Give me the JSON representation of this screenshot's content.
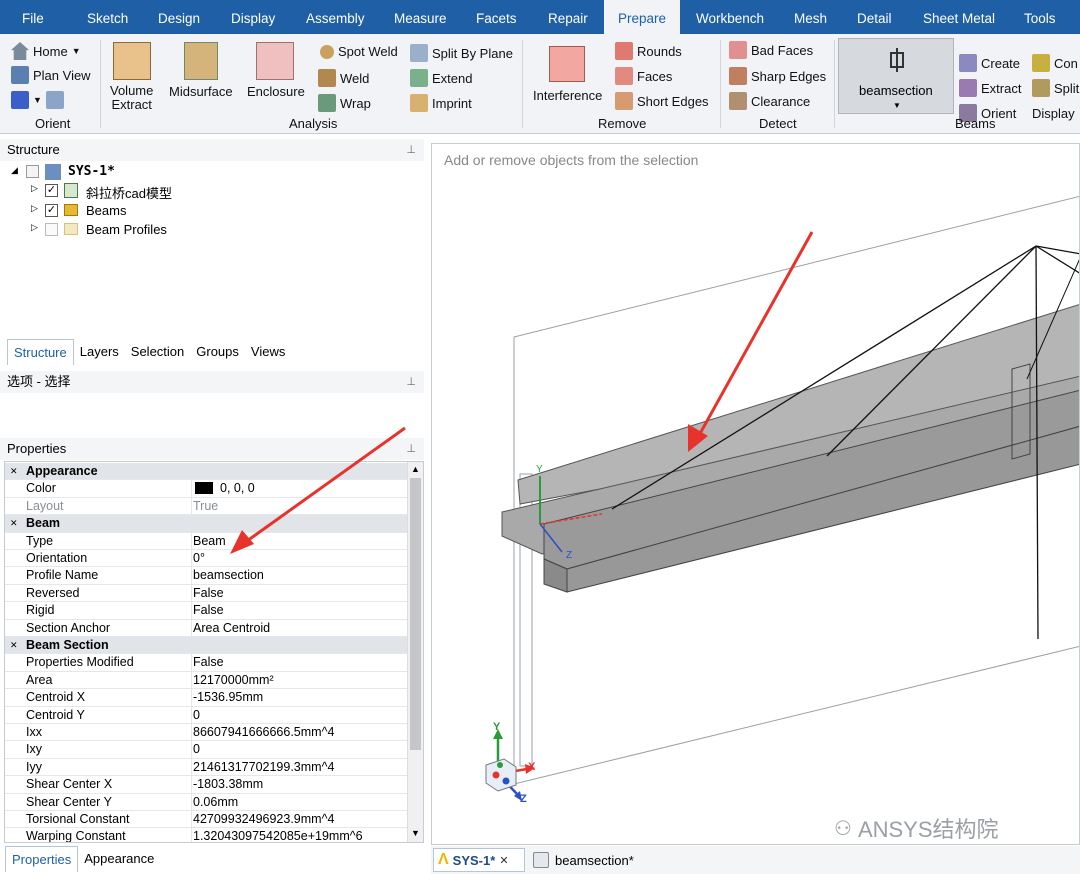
{
  "menubar": {
    "items": [
      "File",
      "Sketch",
      "Design",
      "Display",
      "Assembly",
      "Measure",
      "Facets",
      "Repair",
      "Prepare",
      "Workbench",
      "Mesh",
      "Detail",
      "Sheet Metal",
      "Tools"
    ],
    "active": "Prepare"
  },
  "ribbon": {
    "orient": {
      "home": "Home",
      "plan_view": "Plan View",
      "group": "Orient"
    },
    "analysis": {
      "volume_extract": "Volume\nExtract",
      "midsurface": "Midsurface",
      "enclosure": "Enclosure",
      "spot_weld": "Spot Weld",
      "weld": "Weld",
      "wrap": "Wrap",
      "split_by_plane": "Split By Plane",
      "extend": "Extend",
      "imprint": "Imprint",
      "group": "Analysis"
    },
    "remove": {
      "interference": "Interference",
      "rounds": "Rounds",
      "faces": "Faces",
      "short_edges": "Short Edges",
      "group": "Remove"
    },
    "detect": {
      "bad_faces": "Bad Faces",
      "sharp_edges": "Sharp Edges",
      "clearance": "Clearance",
      "group": "Detect"
    },
    "beams": {
      "beamsection": "beamsection",
      "create": "Create",
      "extract": "Extract",
      "orient": "Orient",
      "con": "Con",
      "split": "Split",
      "display": "Display",
      "group": "Beams"
    }
  },
  "structure": {
    "title": "Structure",
    "root": "SYS-1*",
    "children": [
      "斜拉桥cad模型",
      "Beams",
      "Beam Profiles"
    ],
    "tabs": [
      "Structure",
      "Layers",
      "Selection",
      "Groups",
      "Views"
    ]
  },
  "options": {
    "title": "选项 - 选择"
  },
  "properties": {
    "title": "Properties",
    "rows": [
      {
        "cat": true,
        "k": "Appearance"
      },
      {
        "k": "Color",
        "v": "0, 0, 0",
        "swatch": "#000000"
      },
      {
        "k": "Layout",
        "v": "True",
        "gray": true
      },
      {
        "cat": true,
        "k": "Beam"
      },
      {
        "k": "Type",
        "v": "Beam"
      },
      {
        "k": "Orientation",
        "v": "0°"
      },
      {
        "k": "Profile Name",
        "v": "beamsection"
      },
      {
        "k": "Reversed",
        "v": "False"
      },
      {
        "k": "Rigid",
        "v": "False"
      },
      {
        "k": "Section Anchor",
        "v": "Area Centroid"
      },
      {
        "cat": true,
        "k": "Beam Section"
      },
      {
        "k": "Properties Modified",
        "v": "False"
      },
      {
        "k": "Area",
        "v": "12170000mm²"
      },
      {
        "k": "Centroid X",
        "v": "-1536.95mm"
      },
      {
        "k": "Centroid Y",
        "v": "0"
      },
      {
        "k": "Ixx",
        "v": "86607941666666.5mm^4"
      },
      {
        "k": "Ixy",
        "v": "0"
      },
      {
        "k": "Iyy",
        "v": "21461317702199.3mm^4"
      },
      {
        "k": "Shear Center X",
        "v": "-1803.38mm"
      },
      {
        "k": "Shear Center Y",
        "v": "0.06mm"
      },
      {
        "k": "Torsional Constant",
        "v": "42709932496923.9mm^4"
      },
      {
        "k": "Warping Constant",
        "v": "1.32043097542085e+19mm^6"
      }
    ],
    "tabs": [
      "Properties",
      "Appearance"
    ]
  },
  "viewport": {
    "hint": "Add or remove objects from the selection",
    "triad": {
      "x": "X",
      "y": "Y",
      "z": "Z"
    },
    "watermark": "ANSYS结构院"
  },
  "doc_tabs": [
    "SYS-1*",
    "beamsection*"
  ],
  "colors": {
    "menubar": "#1f5fa6",
    "arrow": "#e8322c"
  }
}
